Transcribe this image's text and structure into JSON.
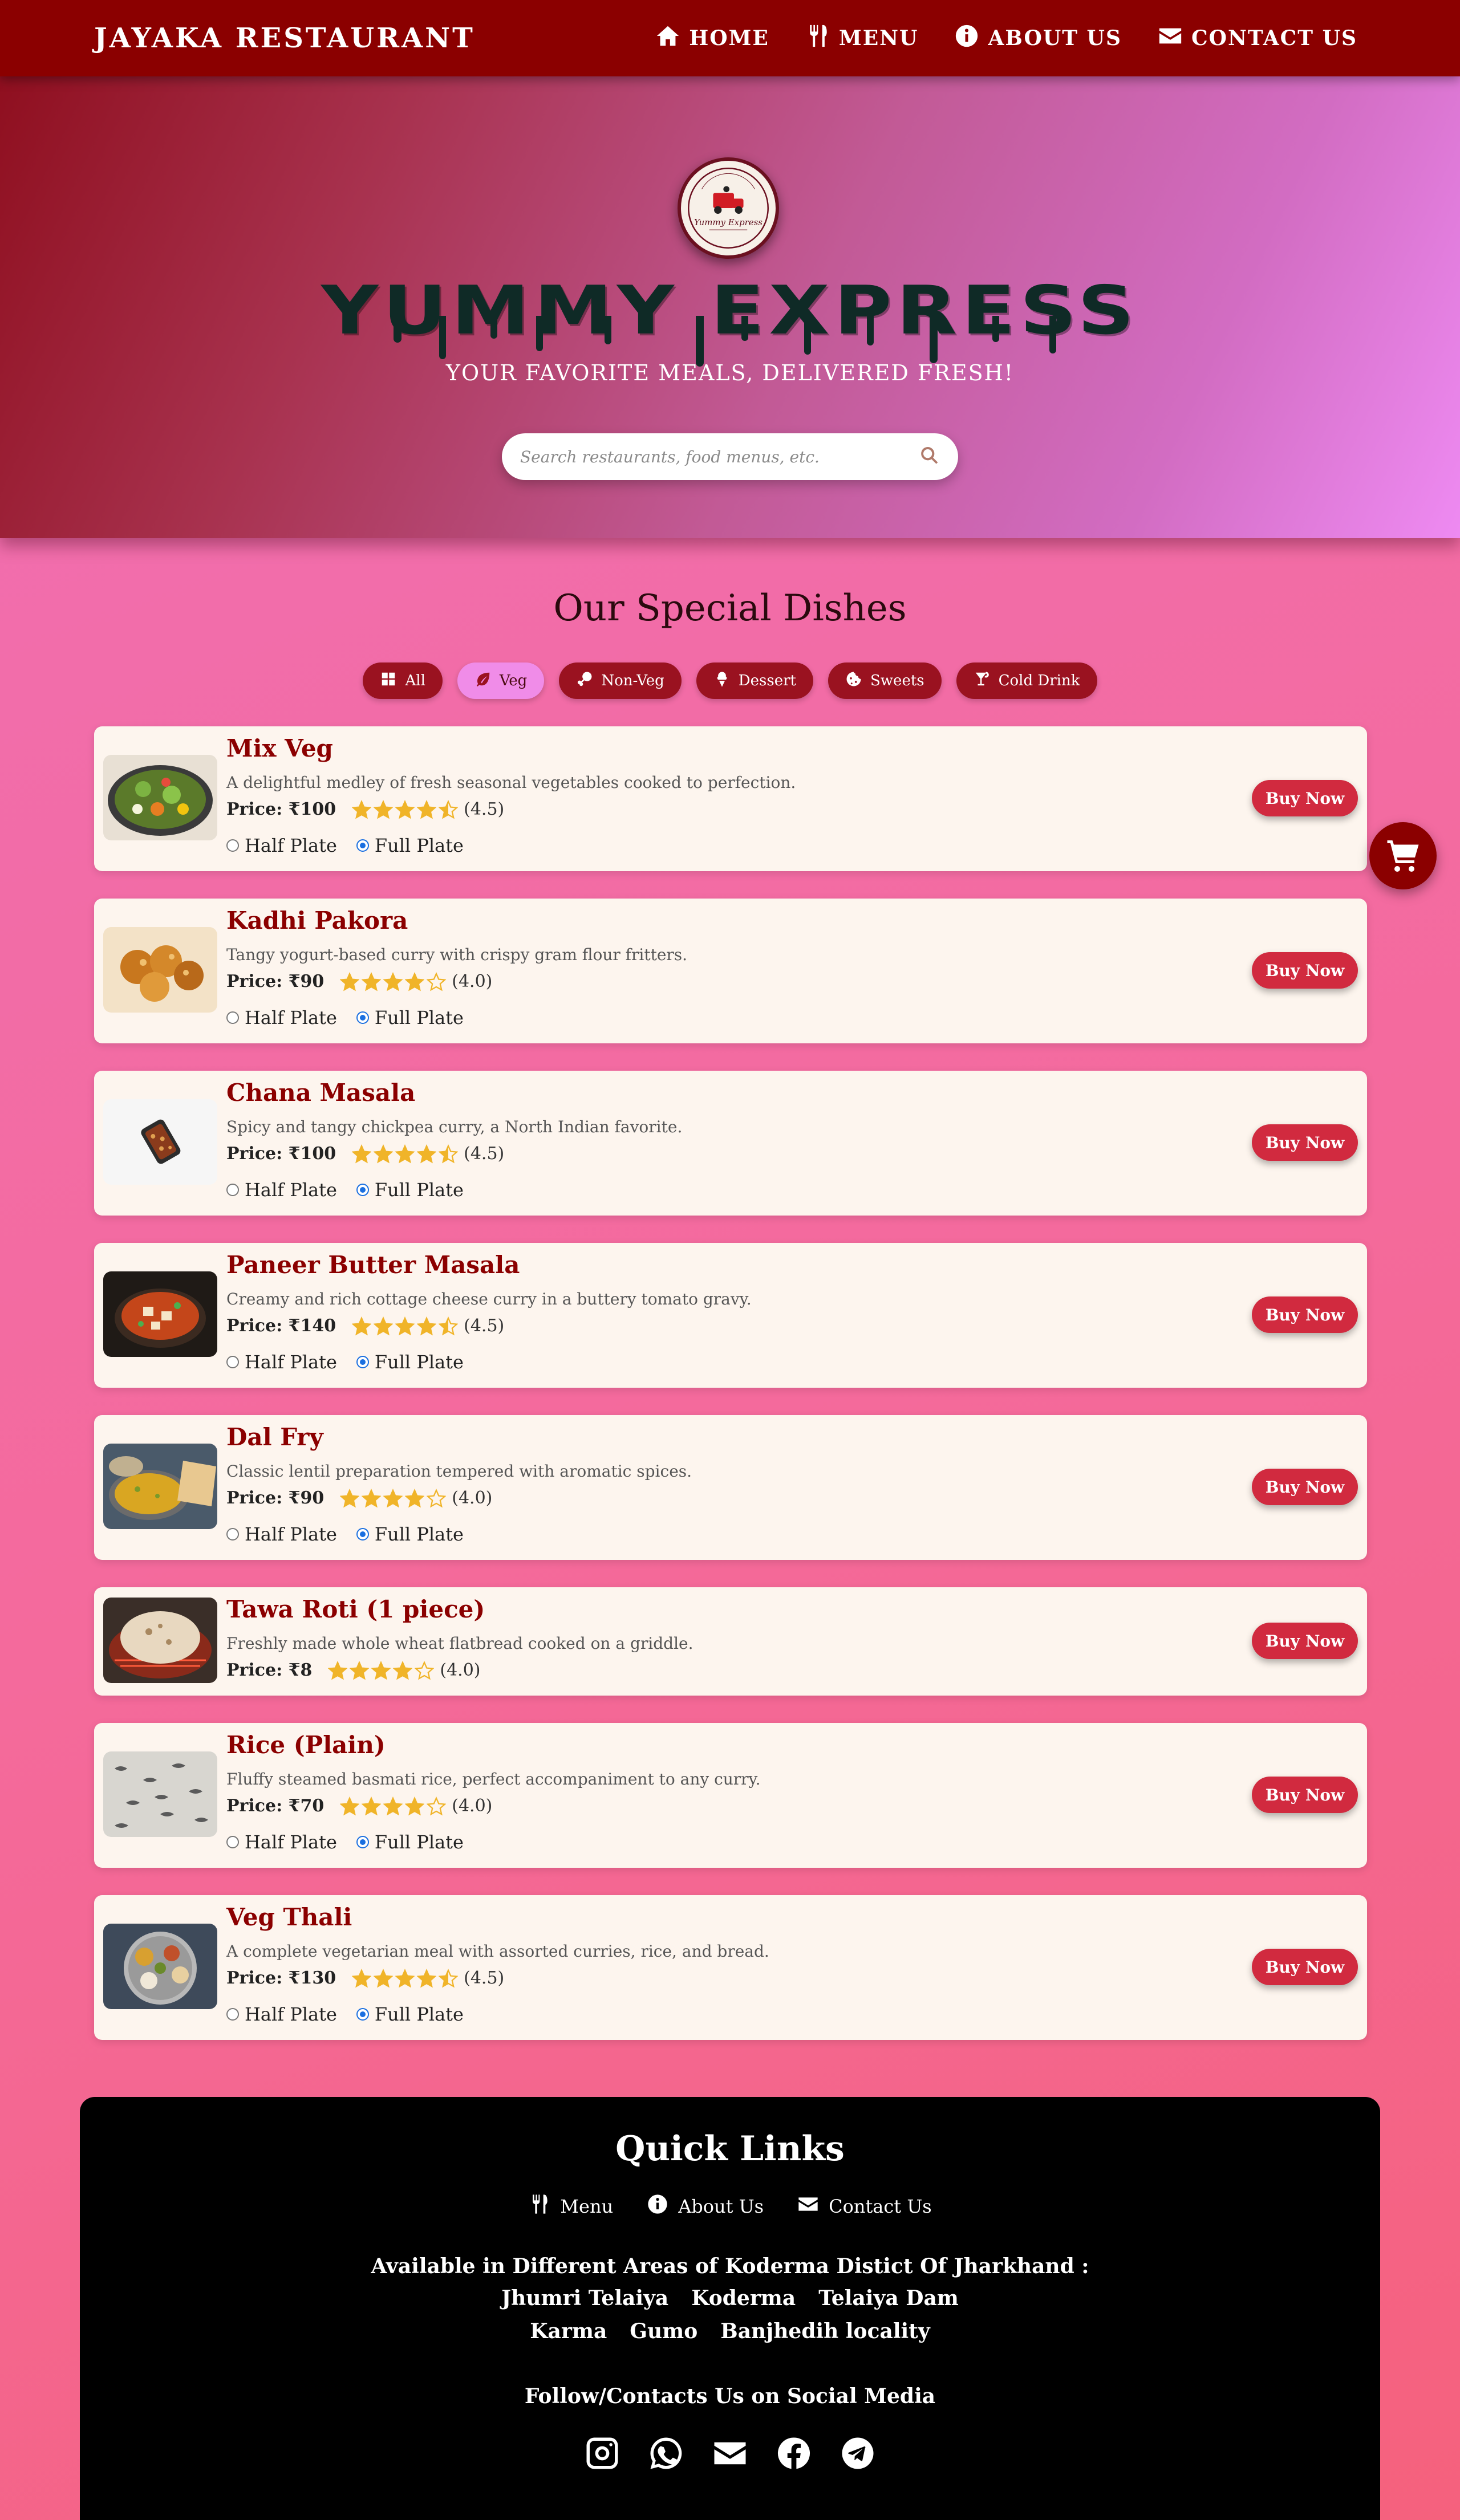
{
  "navbar": {
    "brand": "JAYAKA RESTAURANT",
    "links": [
      {
        "label": "HOME",
        "icon": "home-icon"
      },
      {
        "label": "MENU",
        "icon": "utensils-icon"
      },
      {
        "label": "ABOUT US",
        "icon": "info-icon"
      },
      {
        "label": "CONTACT US",
        "icon": "envelope-icon"
      }
    ]
  },
  "hero": {
    "logo_text": "Yummy Express",
    "logo_ring_text": "FAST FOOD DELIVERY",
    "title": "YUMMY EXPRESS",
    "tagline": "YOUR FAVORITE MEALS, DELIVERED FRESH!",
    "search": {
      "placeholder": "Search restaurants, food menus, etc.",
      "value": ""
    }
  },
  "menu": {
    "title": "Our Special Dishes",
    "filters": [
      {
        "label": "All",
        "icon": "grid-icon",
        "active": false
      },
      {
        "label": "Veg",
        "icon": "leaf-icon",
        "active": true
      },
      {
        "label": "Non-Veg",
        "icon": "drumstick-icon",
        "active": false
      },
      {
        "label": "Dessert",
        "icon": "ice-cream-icon",
        "active": false
      },
      {
        "label": "Sweets",
        "icon": "cookie-icon",
        "active": false
      },
      {
        "label": "Cold Drink",
        "icon": "cocktail-icon",
        "active": false
      }
    ],
    "dishes": [
      {
        "name": "Mix Veg",
        "description": "A delightful medley of fresh seasonal vegetables cooked to perfection.",
        "price": "Price: ₹100",
        "rating": 4.5,
        "rating_text": "(4.5)",
        "options": [
          "Half Plate",
          "Full Plate"
        ],
        "selected_option": "Full Plate",
        "buy_label": "Buy Now",
        "image": "mixed-vegetables-image"
      },
      {
        "name": "Kadhi Pakora",
        "description": "Tangy yogurt-based curry with crispy gram flour fritters.",
        "price": "Price: ₹90",
        "rating": 4.0,
        "rating_text": "(4.0)",
        "options": [
          "Half Plate",
          "Full Plate"
        ],
        "selected_option": "Full Plate",
        "buy_label": "Buy Now",
        "image": "pakora-image"
      },
      {
        "name": "Chana Masala",
        "description": "Spicy and tangy chickpea curry, a North Indian favorite.",
        "price": "Price: ₹100",
        "rating": 4.5,
        "rating_text": "(4.5)",
        "options": [
          "Half Plate",
          "Full Plate"
        ],
        "selected_option": "Full Plate",
        "buy_label": "Buy Now",
        "image": "chana-masala-image"
      },
      {
        "name": "Paneer Butter Masala",
        "description": "Creamy and rich cottage cheese curry in a buttery tomato gravy.",
        "price": "Price: ₹140",
        "rating": 4.5,
        "rating_text": "(4.5)",
        "options": [
          "Half Plate",
          "Full Plate"
        ],
        "selected_option": "Full Plate",
        "buy_label": "Buy Now",
        "image": "paneer-curry-image"
      },
      {
        "name": "Dal Fry",
        "description": "Classic lentil preparation tempered with aromatic spices.",
        "price": "Price: ₹90",
        "rating": 4.0,
        "rating_text": "(4.0)",
        "options": [
          "Half Plate",
          "Full Plate"
        ],
        "selected_option": "Full Plate",
        "buy_label": "Buy Now",
        "image": "dal-fry-image"
      },
      {
        "name": "Tawa Roti (1 piece)",
        "description": "Freshly made whole wheat flatbread cooked on a griddle.",
        "price": "Price: ₹8",
        "rating": 4.0,
        "rating_text": "(4.0)",
        "options": [],
        "selected_option": "",
        "buy_label": "Buy Now",
        "image": "roti-image"
      },
      {
        "name": "Rice (Plain)",
        "description": "Fluffy steamed basmati rice, perfect accompaniment to any curry.",
        "price": "Price: ₹70",
        "rating": 4.0,
        "rating_text": "(4.0)",
        "options": [
          "Half Plate",
          "Full Plate"
        ],
        "selected_option": "Full Plate",
        "buy_label": "Buy Now",
        "image": "rice-image"
      },
      {
        "name": "Veg Thali",
        "description": "A complete vegetarian meal with assorted curries, rice, and bread.",
        "price": "Price: ₹130",
        "rating": 4.5,
        "rating_text": "(4.5)",
        "options": [
          "Half Plate",
          "Full Plate"
        ],
        "selected_option": "Full Plate",
        "buy_label": "Buy Now",
        "image": "thali-image"
      }
    ]
  },
  "cart": {
    "icon": "shopping-cart-icon"
  },
  "footer": {
    "title": "Quick Links",
    "links": [
      {
        "label": "Menu",
        "icon": "utensils-icon"
      },
      {
        "label": "About Us",
        "icon": "info-icon"
      },
      {
        "label": "Contact Us",
        "icon": "envelope-icon"
      }
    ],
    "areas_heading": "Available in Different Areas of Koderma Distict Of Jharkhand :",
    "areas_row1": [
      "Jhumri Telaiya",
      "Koderma",
      "Telaiya Dam"
    ],
    "areas_row2": [
      "Karma",
      "Gumo",
      "Banjhedih locality"
    ],
    "social_heading": "Follow/Contacts Us on Social Media",
    "social": [
      "instagram-icon",
      "whatsapp-icon",
      "envelope-icon",
      "facebook-icon",
      "telegram-icon"
    ]
  },
  "colors": {
    "primary": "#8b0000",
    "button": "#d12a3f",
    "active_filter": "#f08ce8",
    "star": "#f0b429",
    "card": "#fdf5ee"
  }
}
